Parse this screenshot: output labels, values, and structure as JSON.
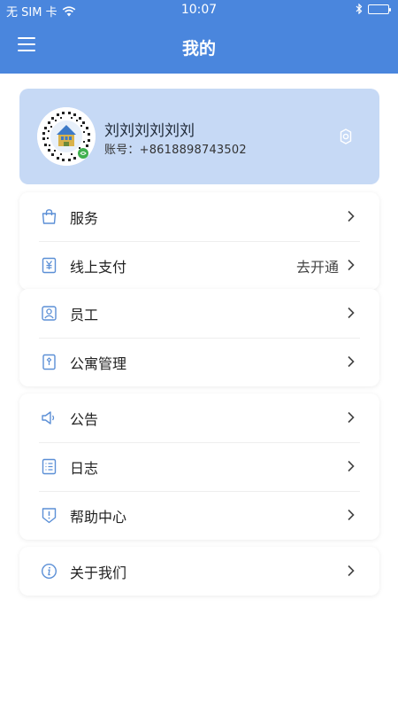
{
  "statusbar": {
    "carrier": "无 SIM 卡",
    "time": "10:07"
  },
  "navbar": {
    "title": "我的"
  },
  "profile": {
    "name": "刘刘刘刘刘刘",
    "account": "账号：+8618898743502"
  },
  "menu_groups": [
    {
      "items": [
        {
          "label": "服务",
          "icon": "bag-icon"
        },
        {
          "label": "线上支付",
          "value": "去开通",
          "icon": "yuan-icon"
        }
      ]
    },
    {
      "items": [
        {
          "label": "员工",
          "icon": "person-icon"
        },
        {
          "label": "公寓管理",
          "icon": "apartment-icon"
        }
      ]
    },
    {
      "items": [
        {
          "label": "公告",
          "icon": "speaker-icon"
        },
        {
          "label": "日志",
          "icon": "list-icon"
        },
        {
          "label": "帮助中心",
          "icon": "help-shield-icon"
        }
      ]
    },
    {
      "items": [
        {
          "label": "关于我们",
          "icon": "info-icon"
        }
      ]
    }
  ],
  "colors": {
    "header": "#4a86dd",
    "profile_card": "#c6d9f5",
    "icon": "#5b8fd6"
  }
}
